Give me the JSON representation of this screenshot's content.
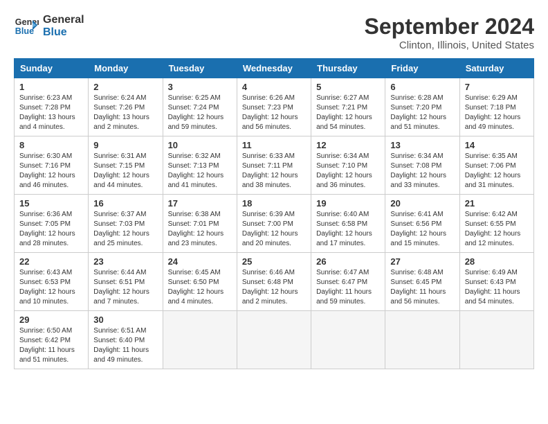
{
  "logo": {
    "line1": "General",
    "line2": "Blue"
  },
  "title": "September 2024",
  "subtitle": "Clinton, Illinois, United States",
  "weekdays": [
    "Sunday",
    "Monday",
    "Tuesday",
    "Wednesday",
    "Thursday",
    "Friday",
    "Saturday"
  ],
  "weeks": [
    [
      {
        "day": "1",
        "sunrise": "6:23 AM",
        "sunset": "7:28 PM",
        "daylight": "13 hours and 4 minutes."
      },
      {
        "day": "2",
        "sunrise": "6:24 AM",
        "sunset": "7:26 PM",
        "daylight": "13 hours and 2 minutes."
      },
      {
        "day": "3",
        "sunrise": "6:25 AM",
        "sunset": "7:24 PM",
        "daylight": "12 hours and 59 minutes."
      },
      {
        "day": "4",
        "sunrise": "6:26 AM",
        "sunset": "7:23 PM",
        "daylight": "12 hours and 56 minutes."
      },
      {
        "day": "5",
        "sunrise": "6:27 AM",
        "sunset": "7:21 PM",
        "daylight": "12 hours and 54 minutes."
      },
      {
        "day": "6",
        "sunrise": "6:28 AM",
        "sunset": "7:20 PM",
        "daylight": "12 hours and 51 minutes."
      },
      {
        "day": "7",
        "sunrise": "6:29 AM",
        "sunset": "7:18 PM",
        "daylight": "12 hours and 49 minutes."
      }
    ],
    [
      {
        "day": "8",
        "sunrise": "6:30 AM",
        "sunset": "7:16 PM",
        "daylight": "12 hours and 46 minutes."
      },
      {
        "day": "9",
        "sunrise": "6:31 AM",
        "sunset": "7:15 PM",
        "daylight": "12 hours and 44 minutes."
      },
      {
        "day": "10",
        "sunrise": "6:32 AM",
        "sunset": "7:13 PM",
        "daylight": "12 hours and 41 minutes."
      },
      {
        "day": "11",
        "sunrise": "6:33 AM",
        "sunset": "7:11 PM",
        "daylight": "12 hours and 38 minutes."
      },
      {
        "day": "12",
        "sunrise": "6:34 AM",
        "sunset": "7:10 PM",
        "daylight": "12 hours and 36 minutes."
      },
      {
        "day": "13",
        "sunrise": "6:34 AM",
        "sunset": "7:08 PM",
        "daylight": "12 hours and 33 minutes."
      },
      {
        "day": "14",
        "sunrise": "6:35 AM",
        "sunset": "7:06 PM",
        "daylight": "12 hours and 31 minutes."
      }
    ],
    [
      {
        "day": "15",
        "sunrise": "6:36 AM",
        "sunset": "7:05 PM",
        "daylight": "12 hours and 28 minutes."
      },
      {
        "day": "16",
        "sunrise": "6:37 AM",
        "sunset": "7:03 PM",
        "daylight": "12 hours and 25 minutes."
      },
      {
        "day": "17",
        "sunrise": "6:38 AM",
        "sunset": "7:01 PM",
        "daylight": "12 hours and 23 minutes."
      },
      {
        "day": "18",
        "sunrise": "6:39 AM",
        "sunset": "7:00 PM",
        "daylight": "12 hours and 20 minutes."
      },
      {
        "day": "19",
        "sunrise": "6:40 AM",
        "sunset": "6:58 PM",
        "daylight": "12 hours and 17 minutes."
      },
      {
        "day": "20",
        "sunrise": "6:41 AM",
        "sunset": "6:56 PM",
        "daylight": "12 hours and 15 minutes."
      },
      {
        "day": "21",
        "sunrise": "6:42 AM",
        "sunset": "6:55 PM",
        "daylight": "12 hours and 12 minutes."
      }
    ],
    [
      {
        "day": "22",
        "sunrise": "6:43 AM",
        "sunset": "6:53 PM",
        "daylight": "12 hours and 10 minutes."
      },
      {
        "day": "23",
        "sunrise": "6:44 AM",
        "sunset": "6:51 PM",
        "daylight": "12 hours and 7 minutes."
      },
      {
        "day": "24",
        "sunrise": "6:45 AM",
        "sunset": "6:50 PM",
        "daylight": "12 hours and 4 minutes."
      },
      {
        "day": "25",
        "sunrise": "6:46 AM",
        "sunset": "6:48 PM",
        "daylight": "12 hours and 2 minutes."
      },
      {
        "day": "26",
        "sunrise": "6:47 AM",
        "sunset": "6:47 PM",
        "daylight": "11 hours and 59 minutes."
      },
      {
        "day": "27",
        "sunrise": "6:48 AM",
        "sunset": "6:45 PM",
        "daylight": "11 hours and 56 minutes."
      },
      {
        "day": "28",
        "sunrise": "6:49 AM",
        "sunset": "6:43 PM",
        "daylight": "11 hours and 54 minutes."
      }
    ],
    [
      {
        "day": "29",
        "sunrise": "6:50 AM",
        "sunset": "6:42 PM",
        "daylight": "11 hours and 51 minutes."
      },
      {
        "day": "30",
        "sunrise": "6:51 AM",
        "sunset": "6:40 PM",
        "daylight": "11 hours and 49 minutes."
      },
      null,
      null,
      null,
      null,
      null
    ]
  ]
}
